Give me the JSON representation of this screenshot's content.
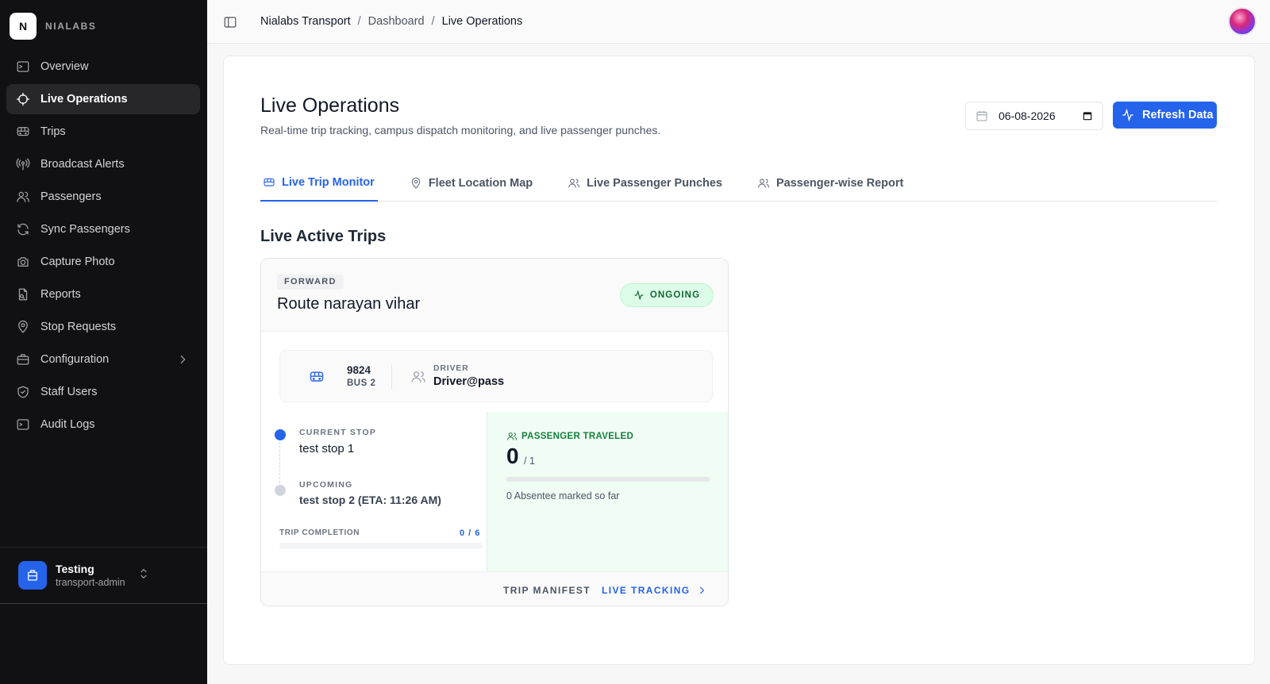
{
  "brand": {
    "logo_letter": "N",
    "name": "NIALABS"
  },
  "sidebar": {
    "items": [
      {
        "label": "Overview",
        "icon": "terminal-icon"
      },
      {
        "label": "Live Operations",
        "icon": "crosshair-icon",
        "active": true
      },
      {
        "label": "Trips",
        "icon": "bus-icon"
      },
      {
        "label": "Broadcast Alerts",
        "icon": "radio-icon"
      },
      {
        "label": "Passengers",
        "icon": "users-icon"
      },
      {
        "label": "Sync Passengers",
        "icon": "refresh-icon"
      },
      {
        "label": "Capture Photo",
        "icon": "camera-icon"
      },
      {
        "label": "Reports",
        "icon": "file-icon"
      },
      {
        "label": "Stop Requests",
        "icon": "map-pin-icon"
      },
      {
        "label": "Configuration",
        "icon": "briefcase-icon",
        "has_submenu": true
      },
      {
        "label": "Staff Users",
        "icon": "shield-icon"
      },
      {
        "label": "Audit Logs",
        "icon": "terminal-icon"
      }
    ]
  },
  "user": {
    "name": "Testing",
    "role": "transport-admin"
  },
  "breadcrumb": {
    "items": [
      "Nialabs Transport",
      "Dashboard",
      "Live Operations"
    ]
  },
  "page": {
    "title": "Live Operations",
    "subtitle": "Real-time trip tracking, campus dispatch monitoring, and live passenger punches.",
    "date": "06-08-2026",
    "refresh_label": "Refresh Data"
  },
  "tabs": [
    {
      "label": "Live Trip Monitor",
      "icon": "bus-icon",
      "active": true
    },
    {
      "label": "Fleet Location Map",
      "icon": "map-pin-icon"
    },
    {
      "label": "Live Passenger Punches",
      "icon": "users-icon"
    },
    {
      "label": "Passenger-wise Report",
      "icon": "users-icon"
    }
  ],
  "section_title": "Live Active Trips",
  "trip": {
    "direction": "FORWARD",
    "route": "Route narayan vihar",
    "status": "ONGOING",
    "bus_number": "9824",
    "bus_name": "BUS 2",
    "driver_label": "DRIVER",
    "driver_name": "Driver@pass",
    "current_stop_label": "CURRENT STOP",
    "current_stop": "test stop 1",
    "upcoming_label": "UPCOMING",
    "upcoming_stop": "test stop 2 (ETA: 11:26 AM)",
    "completion_label": "TRIP COMPLETION",
    "completion_text": "0 / 6",
    "completion_fraction": 0,
    "passenger_label": "PASSENGER TRAVELED",
    "passenger_count": "0",
    "passenger_total": "/ 1",
    "passenger_fraction": 0,
    "absentee_text": "0 Absentee marked so far",
    "manifest_label": "TRIP MANIFEST",
    "tracking_label": "LIVE TRACKING"
  },
  "colors": {
    "accent": "#2563eb",
    "sidebar_bg": "#111113",
    "success": "#16a34a"
  }
}
